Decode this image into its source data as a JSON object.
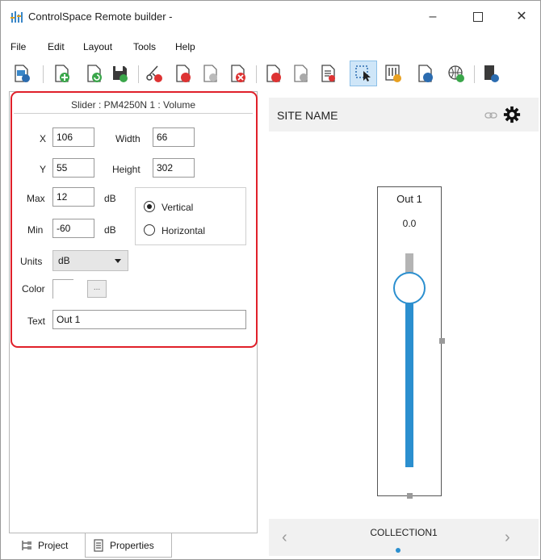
{
  "window": {
    "title": "ControlSpace Remote builder -",
    "minimize_glyph": "–",
    "close_glyph": "✕"
  },
  "menu": [
    "File",
    "Edit",
    "Layout",
    "Tools",
    "Help"
  ],
  "toolbar": {
    "icons": [
      "open-design-icon",
      "new-page-icon",
      "refresh-page-icon",
      "save-icon",
      "cut-icon",
      "delete-page-icon",
      "page-blank-icon",
      "page-remove-icon",
      "page-red-icon",
      "page-gray-icon",
      "page-list-icon",
      "select-pointer-icon",
      "keypad-icon",
      "page-blue-icon",
      "network-globe-icon",
      "device-icon"
    ],
    "active_tool": "select-pointer-icon"
  },
  "properties": {
    "header": "Slider : PM4250N 1 : Volume",
    "x_label": "X",
    "x_value": "106",
    "y_label": "Y",
    "y_value": "55",
    "width_label": "Width",
    "width_value": "66",
    "height_label": "Height",
    "height_value": "302",
    "max_label": "Max",
    "max_value": "12",
    "max_unit": "dB",
    "min_label": "Min",
    "min_value": "-60",
    "min_unit": "dB",
    "orientation": {
      "vertical_label": "Vertical",
      "horizontal_label": "Horizontal",
      "selected": "Vertical"
    },
    "units_label": "Units",
    "units_value": "dB",
    "color_label": "Color",
    "color_button_label": "...",
    "text_label": "Text",
    "text_value": "Out 1"
  },
  "tabs": {
    "project_label": "Project",
    "properties_label": "Properties",
    "active": "Properties"
  },
  "preview": {
    "site_name": "SITE NAME",
    "slider_title": "Out 1",
    "slider_value": "0.0",
    "collection": "COLLECTION1",
    "prev_arrow": "‹",
    "next_arrow": "›"
  },
  "colors": {
    "accent": "#2b8fcf",
    "highlight": "#e0202a",
    "track": "#b4b4b4"
  }
}
